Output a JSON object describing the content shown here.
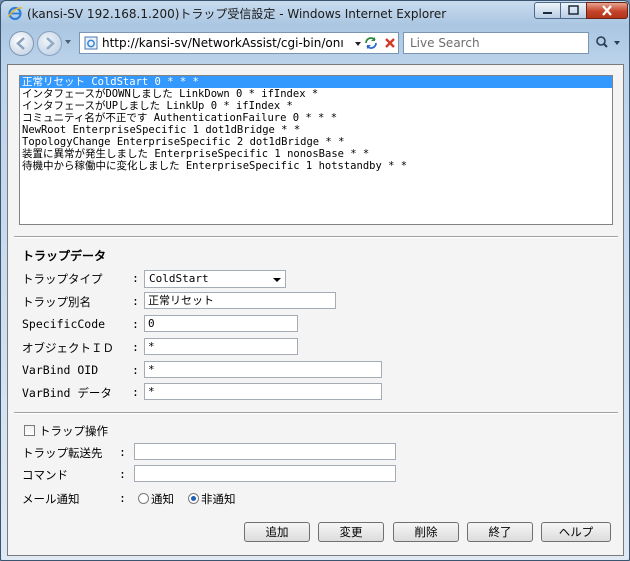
{
  "window": {
    "title": "(kansi-SV 192.168.1.200)トラップ受信設定 - Windows Internet Explorer"
  },
  "address_bar": {
    "url": "http://kansi-sv/NetworkAssist/cgi-bin/onı",
    "search_placeholder": "Live Search"
  },
  "trap_list": {
    "items": [
      "正常リセット ColdStart 0 * * *",
      "インタフェースがDOWNしました LinkDown 0 * ifIndex *",
      "インタフェースがUPしました LinkUp 0 * ifIndex *",
      "コミュニティ名が不正です AuthenticationFailure 0 * * *",
      "NewRoot EnterpriseSpecific 1 dot1dBridge * *",
      "TopologyChange EnterpriseSpecific 2 dot1dBridge * *",
      "装置に異常が発生しました EnterpriseSpecific 1 nonosBase * *",
      "待機中から稼働中に変化しました EnterpriseSpecific 1 hotstandby * *"
    ],
    "selected_index": 0
  },
  "trap_data": {
    "heading": "トラップデータ",
    "colon": ":",
    "type_label": "トラップタイプ",
    "type_value": "ColdStart",
    "alias_label": "トラップ別名",
    "alias_value": "正常リセット",
    "specific_label": "SpecificCode",
    "specific_value": "0",
    "oid_label": "オブジェクトＩＤ",
    "oid_value": "*",
    "varbind_oid_label": "VarBind OID",
    "varbind_oid_value": "*",
    "varbind_data_label": "VarBind データ",
    "varbind_data_value": "*"
  },
  "trap_operation": {
    "checkbox_label": "トラップ操作",
    "checked": false,
    "forward_label": "トラップ転送先",
    "forward_value": "",
    "command_label": "コマンド",
    "command_value": "",
    "mail_label": "メール通知",
    "mail_options": [
      "通知",
      "非通知"
    ],
    "mail_selected": "非通知"
  },
  "buttons": {
    "add": "追加",
    "change": "変更",
    "delete": "削除",
    "exit": "終了",
    "help": "ヘルプ"
  }
}
